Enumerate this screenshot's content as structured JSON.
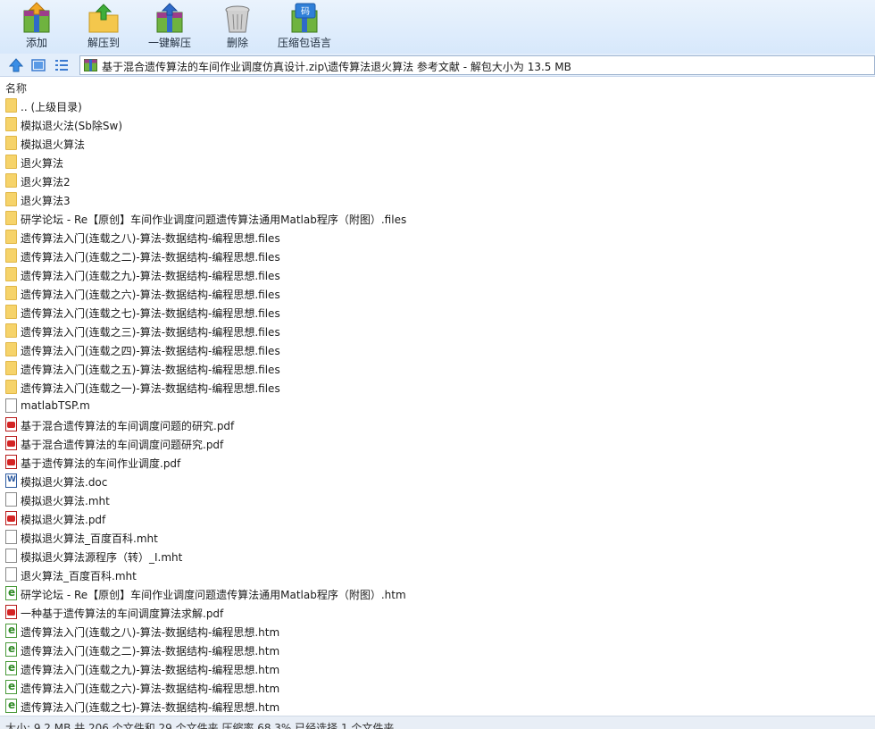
{
  "toolbar": {
    "buttons": [
      {
        "label": "添加",
        "icon": "add-archive-icon"
      },
      {
        "label": "解压到",
        "icon": "extract-to-icon"
      },
      {
        "label": "一键解压",
        "icon": "one-click-extract-icon"
      },
      {
        "label": "删除",
        "icon": "delete-trash-icon"
      },
      {
        "label": "压缩包语言",
        "icon": "archive-language-icon"
      }
    ],
    "lang_badge": "码"
  },
  "address": {
    "path": "基于混合遗传算法的车间作业调度仿真设计.zip\\遗传算法退火算法 参考文献 - 解包大小为 13.5 MB"
  },
  "columns": {
    "name": "名称"
  },
  "files": [
    {
      "name": ".. (上级目录)",
      "type": "folder"
    },
    {
      "name": "模拟退火法(Sb除Sw)",
      "type": "folder"
    },
    {
      "name": "模拟退火算法",
      "type": "folder"
    },
    {
      "name": "退火算法",
      "type": "folder"
    },
    {
      "name": "退火算法2",
      "type": "folder"
    },
    {
      "name": "退火算法3",
      "type": "folder"
    },
    {
      "name": "研学论坛 - Re【原创】车间作业调度问题遗传算法通用Matlab程序（附图）.files",
      "type": "folder"
    },
    {
      "name": "遗传算法入门(连载之八)-算法-数据结构-编程思想.files",
      "type": "folder"
    },
    {
      "name": "遗传算法入门(连载之二)-算法-数据结构-编程思想.files",
      "type": "folder"
    },
    {
      "name": "遗传算法入门(连载之九)-算法-数据结构-编程思想.files",
      "type": "folder"
    },
    {
      "name": "遗传算法入门(连载之六)-算法-数据结构-编程思想.files",
      "type": "folder"
    },
    {
      "name": "遗传算法入门(连载之七)-算法-数据结构-编程思想.files",
      "type": "folder"
    },
    {
      "name": "遗传算法入门(连载之三)-算法-数据结构-编程思想.files",
      "type": "folder"
    },
    {
      "name": "遗传算法入门(连载之四)-算法-数据结构-编程思想.files",
      "type": "folder"
    },
    {
      "name": "遗传算法入门(连载之五)-算法-数据结构-编程思想.files",
      "type": "folder"
    },
    {
      "name": "遗传算法入门(连载之一)-算法-数据结构-编程思想.files",
      "type": "folder"
    },
    {
      "name": "matlabTSP.m",
      "type": "file"
    },
    {
      "name": "基于混合遗传算法的车间调度问题的研究.pdf",
      "type": "pdf"
    },
    {
      "name": "基于混合遗传算法的车间调度问题研究.pdf",
      "type": "pdf"
    },
    {
      "name": "基于遗传算法的车间作业调度.pdf",
      "type": "pdf"
    },
    {
      "name": "模拟退火算法.doc",
      "type": "doc"
    },
    {
      "name": "模拟退火算法.mht",
      "type": "file"
    },
    {
      "name": "模拟退火算法.pdf",
      "type": "pdf"
    },
    {
      "name": "模拟退火算法_百度百科.mht",
      "type": "file"
    },
    {
      "name": "模拟退火算法源程序（转）_I.mht",
      "type": "file"
    },
    {
      "name": "退火算法_百度百科.mht",
      "type": "file"
    },
    {
      "name": "研学论坛 - Re【原创】车间作业调度问题遗传算法通用Matlab程序（附图）.htm",
      "type": "htm"
    },
    {
      "name": "一种基于遗传算法的车间调度算法求解.pdf",
      "type": "pdf"
    },
    {
      "name": "遗传算法入门(连载之八)-算法-数据结构-编程思想.htm",
      "type": "htm"
    },
    {
      "name": "遗传算法入门(连载之二)-算法-数据结构-编程思想.htm",
      "type": "htm"
    },
    {
      "name": "遗传算法入门(连载之九)-算法-数据结构-编程思想.htm",
      "type": "htm"
    },
    {
      "name": "遗传算法入门(连载之六)-算法-数据结构-编程思想.htm",
      "type": "htm"
    },
    {
      "name": "遗传算法入门(连载之七)-算法-数据结构-编程思想.htm",
      "type": "htm"
    }
  ],
  "status": {
    "text": "大小: 9.2 MB 共 206 个文件和 29 个文件夹 压缩率 68.3% 已经选择 1 个文件夹"
  },
  "colors": {
    "toolbar_bg": "#d7e8fb",
    "folder": "#f6d36a",
    "pdf": "#d42323",
    "accent": "#2c6fd1"
  }
}
